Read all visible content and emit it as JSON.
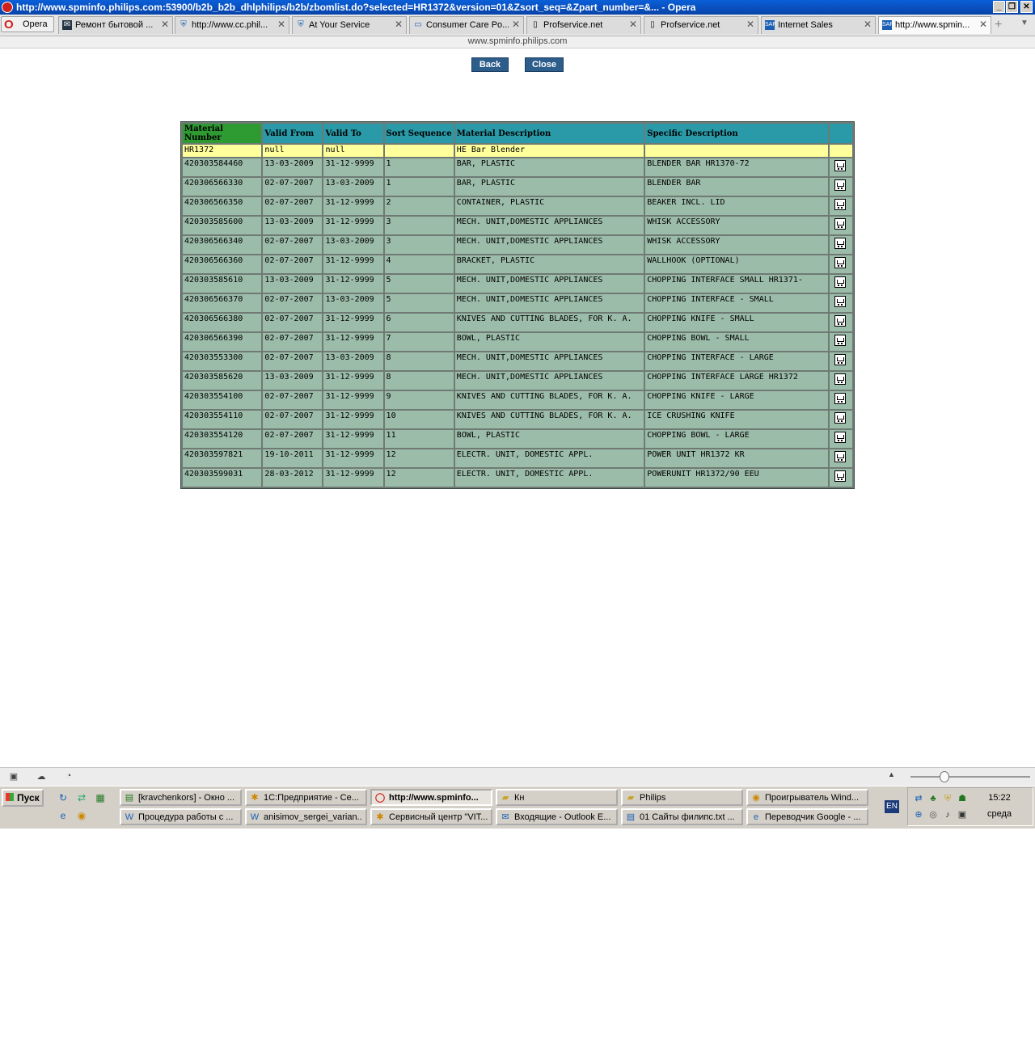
{
  "window": {
    "title": "http://www.spminfo.philips.com:53900/b2b_b2b_dhlphilips/b2b/zbomlist.do?selected=HR1372&version=01&Zsort_seq=&Zpart_number=&... - Opera"
  },
  "browser": {
    "menu_label": "Opera",
    "tabs": [
      {
        "label": "Ремонт бытовой ..."
      },
      {
        "label": "http://www.cc.phil..."
      },
      {
        "label": "At Your Service"
      },
      {
        "label": "Consumer Care Po..."
      },
      {
        "label": "Profservice.net"
      },
      {
        "label": "Profservice.net"
      },
      {
        "label": "Internet Sales"
      },
      {
        "label": "http://www.spmin..."
      }
    ],
    "address": "www.spminfo.philips.com"
  },
  "page": {
    "back_label": "Back",
    "close_label": "Close",
    "table": {
      "headers": [
        "Material Number",
        "Valid From",
        "Valid To",
        "Sort Sequence",
        "Material Description",
        "Specific Description",
        ""
      ],
      "header_row": [
        "HR1372",
        "null",
        "null",
        "",
        "HE Bar Blender",
        "",
        ""
      ],
      "rows": [
        [
          "420303584460",
          "13-03-2009",
          "31-12-9999",
          "1",
          "BAR, PLASTIC",
          "BLENDER BAR HR1370-72"
        ],
        [
          "420306566330",
          "02-07-2007",
          "13-03-2009",
          "1",
          "BAR, PLASTIC",
          "BLENDER BAR"
        ],
        [
          "420306566350",
          "02-07-2007",
          "31-12-9999",
          "2",
          "CONTAINER, PLASTIC",
          "BEAKER INCL. LID"
        ],
        [
          "420303585600",
          "13-03-2009",
          "31-12-9999",
          "3",
          "MECH. UNIT,DOMESTIC APPLIANCES",
          "WHISK ACCESSORY"
        ],
        [
          "420306566340",
          "02-07-2007",
          "13-03-2009",
          "3",
          "MECH. UNIT,DOMESTIC APPLIANCES",
          "WHISK ACCESSORY"
        ],
        [
          "420306566360",
          "02-07-2007",
          "31-12-9999",
          "4",
          "BRACKET, PLASTIC",
          "WALLHOOK (OPTIONAL)"
        ],
        [
          "420303585610",
          "13-03-2009",
          "31-12-9999",
          "5",
          "MECH. UNIT,DOMESTIC APPLIANCES",
          "CHOPPING INTERFACE SMALL HR1371-"
        ],
        [
          "420306566370",
          "02-07-2007",
          "13-03-2009",
          "5",
          "MECH. UNIT,DOMESTIC APPLIANCES",
          "CHOPPING INTERFACE - SMALL"
        ],
        [
          "420306566380",
          "02-07-2007",
          "31-12-9999",
          "6",
          "KNIVES AND CUTTING BLADES, FOR K. A.",
          "CHOPPING KNIFE - SMALL"
        ],
        [
          "420306566390",
          "02-07-2007",
          "31-12-9999",
          "7",
          "BOWL, PLASTIC",
          "CHOPPING BOWL - SMALL"
        ],
        [
          "420303553300",
          "02-07-2007",
          "13-03-2009",
          "8",
          "MECH. UNIT,DOMESTIC APPLIANCES",
          "CHOPPING INTERFACE - LARGE"
        ],
        [
          "420303585620",
          "13-03-2009",
          "31-12-9999",
          "8",
          "MECH. UNIT,DOMESTIC APPLIANCES",
          "CHOPPING INTERFACE LARGE HR1372"
        ],
        [
          "420303554100",
          "02-07-2007",
          "31-12-9999",
          "9",
          "KNIVES AND CUTTING BLADES, FOR K. A.",
          "CHOPPING KNIFE - LARGE"
        ],
        [
          "420303554110",
          "02-07-2007",
          "31-12-9999",
          "10",
          "KNIVES AND CUTTING BLADES, FOR K. A.",
          "ICE CRUSHING KNIFE"
        ],
        [
          "420303554120",
          "02-07-2007",
          "31-12-9999",
          "11",
          "BOWL, PLASTIC",
          "CHOPPING BOWL - LARGE"
        ],
        [
          "420303597821",
          "19-10-2011",
          "31-12-9999",
          "12",
          "ELECTR. UNIT, DOMESTIC APPL.",
          "POWER UNIT HR1372 KR"
        ],
        [
          "420303599031",
          "28-03-2012",
          "31-12-9999",
          "12",
          "ELECTR. UNIT, DOMESTIC APPL.",
          "POWERUNIT HR1372/90 EEU"
        ]
      ],
      "action_icon": "cart-icon"
    }
  },
  "taskbar": {
    "start_label": "Пуск",
    "tasks_row1": [
      {
        "label": "[kravchenkors] - Окно ..."
      },
      {
        "label": "1С:Предприятие - Се..."
      },
      {
        "label": "http://www.spminfo..."
      },
      {
        "label": "Кн"
      },
      {
        "label": "Philips"
      },
      {
        "label": "Проигрыватель Wind..."
      }
    ],
    "tasks_row2": [
      {
        "label": "Процедура работы с ..."
      },
      {
        "label": "anisimov_sergei_varian..."
      },
      {
        "label": "Сервисный центр \"VIT..."
      },
      {
        "label": "Входящие - Outlook E..."
      },
      {
        "label": "01 Сайты филипс.txt ..."
      },
      {
        "label": "Переводчик Google - ..."
      }
    ],
    "language": "EN",
    "time": "15:22",
    "day": "среда"
  }
}
